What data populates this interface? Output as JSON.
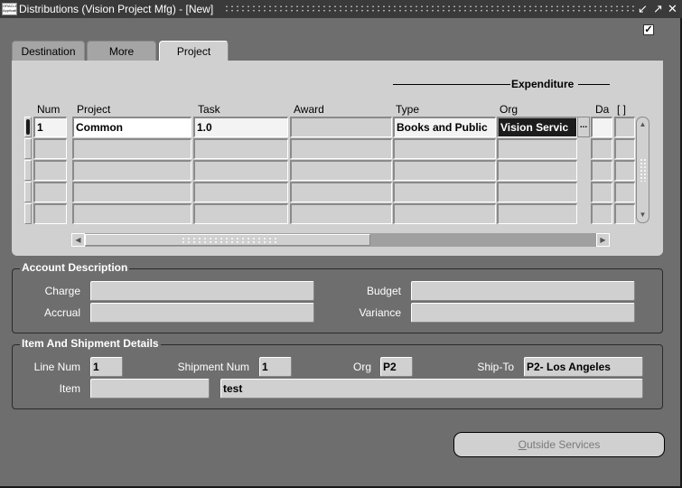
{
  "window": {
    "title": "Distributions (Vision Project Mfg) - [New]",
    "app_icon": "oracle-logo-icon",
    "controls": {
      "minimize": "minimize-icon",
      "maximize": "maximize-icon",
      "close": "close-icon"
    },
    "top_checkbox_checked": true
  },
  "tabs": [
    {
      "label": "Destination",
      "active": false
    },
    {
      "label": "More",
      "active": false
    },
    {
      "label": "Project",
      "active": true
    }
  ],
  "grid": {
    "group_header": "Expenditure",
    "columns": {
      "num": "Num",
      "project": "Project",
      "task": "Task",
      "award": "Award",
      "type": "Type",
      "org": "Org",
      "date": "Da",
      "bracket": "[ ]"
    },
    "rows": [
      {
        "num": "1",
        "project": "Common",
        "task": "1.0",
        "award": "",
        "type": "Books and Public",
        "org": "Vision Servic",
        "date": "",
        "extra": ""
      },
      {
        "num": "",
        "project": "",
        "task": "",
        "award": "",
        "type": "",
        "org": "",
        "date": "",
        "extra": ""
      },
      {
        "num": "",
        "project": "",
        "task": "",
        "award": "",
        "type": "",
        "org": "",
        "date": "",
        "extra": ""
      },
      {
        "num": "",
        "project": "",
        "task": "",
        "award": "",
        "type": "",
        "org": "",
        "date": "",
        "extra": ""
      },
      {
        "num": "",
        "project": "",
        "task": "",
        "award": "",
        "type": "",
        "org": "",
        "date": "",
        "extra": ""
      }
    ],
    "lov_button": "..."
  },
  "account_description": {
    "title": "Account Description",
    "charge_label": "Charge",
    "charge_value": "",
    "accrual_label": "Accrual",
    "accrual_value": "",
    "budget_label": "Budget",
    "budget_value": "",
    "variance_label": "Variance",
    "variance_value": ""
  },
  "item_shipment": {
    "title": "Item And Shipment Details",
    "line_num_label": "Line Num",
    "line_num": "1",
    "shipment_num_label": "Shipment Num",
    "shipment_num": "1",
    "org_label": "Org",
    "org": "P2",
    "ship_to_label": "Ship-To",
    "ship_to": "P2- Los Angeles",
    "item_label": "Item",
    "item": "",
    "item_description": "test"
  },
  "buttons": {
    "outside_services_mnemonic": "O",
    "outside_services_rest": "utside Services"
  }
}
